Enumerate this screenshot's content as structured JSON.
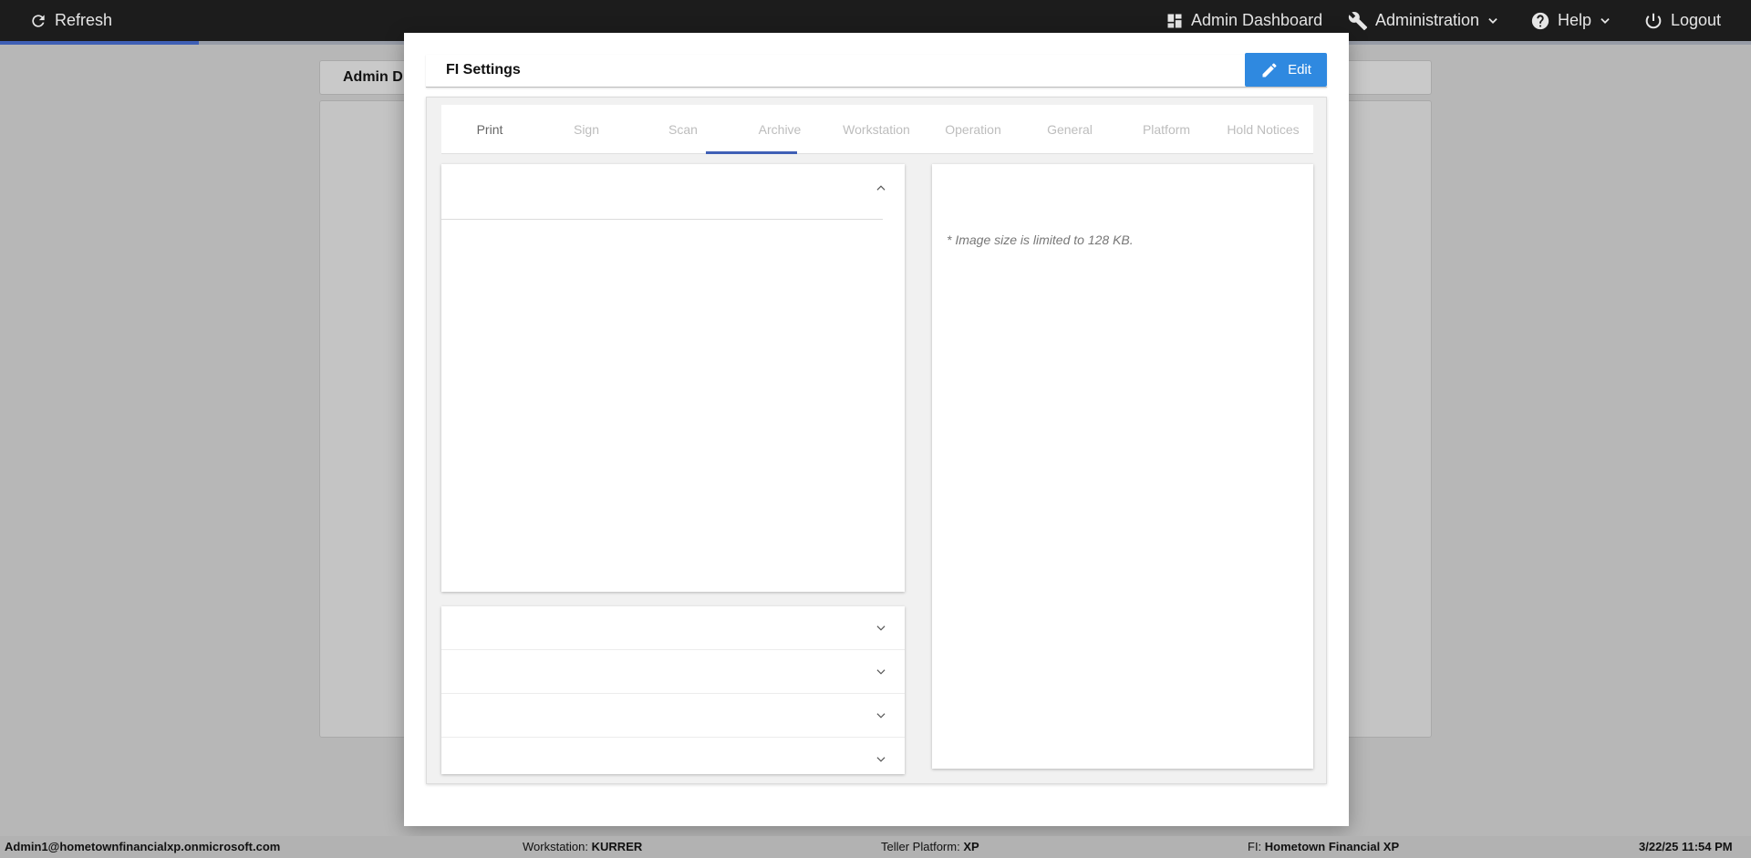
{
  "topbar": {
    "refresh_label": "Refresh",
    "admin_dashboard_label": "Admin Dashboard",
    "administration_label": "Administration",
    "help_label": "Help",
    "logout_label": "Logout"
  },
  "background": {
    "card_title": "Admin D"
  },
  "modal": {
    "title": "FI Settings",
    "edit_label": "Edit",
    "tabs": [
      {
        "label": "Print",
        "active": false
      },
      {
        "label": "Sign",
        "active": false
      },
      {
        "label": "Scan",
        "active": false
      },
      {
        "label": "Archive",
        "active": true
      },
      {
        "label": "Workstation",
        "active": false
      },
      {
        "label": "Operation",
        "active": false
      },
      {
        "label": "General",
        "active": false
      },
      {
        "label": "Platform",
        "active": false
      },
      {
        "label": "Hold Notices",
        "active": false
      }
    ],
    "image_note": "* Image size is limited to 128 KB."
  },
  "statusbar": {
    "user": "Admin1@hometownfinancialxp.onmicrosoft.com",
    "workstation_label": "Workstation:",
    "workstation_value": "KURRER",
    "teller_platform_label": "Teller Platform:",
    "teller_platform_value": "XP",
    "fi_label": "FI:",
    "fi_value": "Hometown Financial XP",
    "datetime": "3/22/25 11:54 PM"
  },
  "colors": {
    "accent": "#2f89e0",
    "tab_indicator": "#3f5fb5",
    "topbar": "#1c1c1c"
  },
  "icons": {
    "refresh": "refresh-icon",
    "dashboard": "dashboard-icon",
    "administration": "wrench-icon",
    "help": "help-circle-icon",
    "logout": "power-icon",
    "edit": "pencil-icon"
  }
}
